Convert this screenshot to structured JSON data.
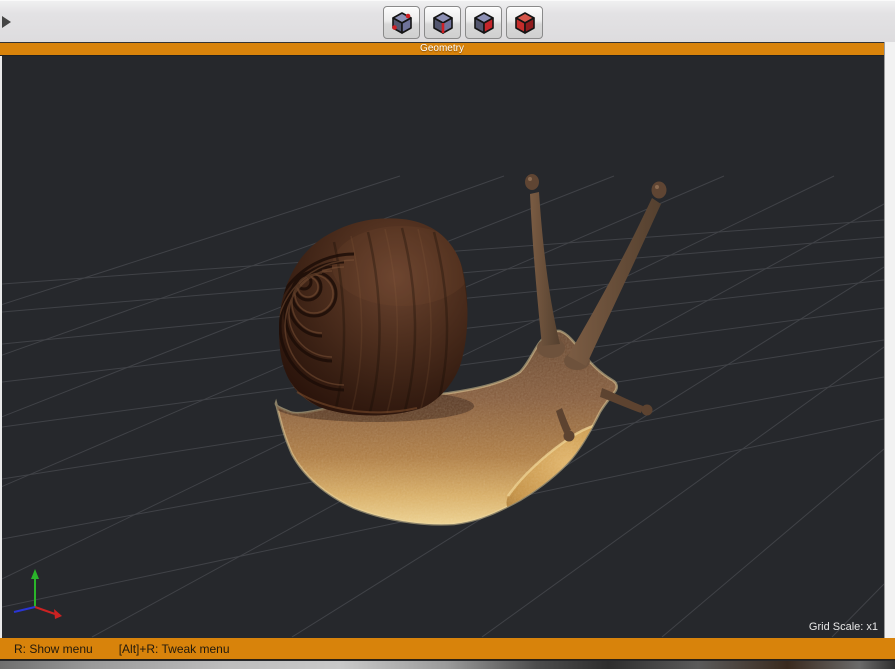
{
  "window": {
    "toolbar": {
      "expand_arrow_icon": "panel-expand-arrow-icon",
      "buttons": [
        {
          "icon": "cube-vertices-icon",
          "mode": "vertices"
        },
        {
          "icon": "cube-edges-icon",
          "mode": "edges"
        },
        {
          "icon": "cube-faces-icon",
          "mode": "faces"
        },
        {
          "icon": "cube-solid-icon",
          "mode": "solid"
        }
      ]
    },
    "panel": {
      "title": "Geometry"
    },
    "viewport": {
      "grid_scale_label": "Grid Scale: x1",
      "model_name": "snail",
      "axis_gizmo_icon": "xyz-axis-gizmo-icon",
      "axis_colors": {
        "x": "#cc2222",
        "y": "#2ab52a",
        "z": "#2a35d4"
      }
    },
    "status_bar": {
      "left_hint": "R: Show menu",
      "right_hint": "[Alt]+R: Tweak menu"
    },
    "colors": {
      "accent_orange": "#d8830b",
      "viewport_background": "#26282c",
      "grid_line": "#47494e",
      "toolbar_background": "#e3e2e4"
    }
  }
}
